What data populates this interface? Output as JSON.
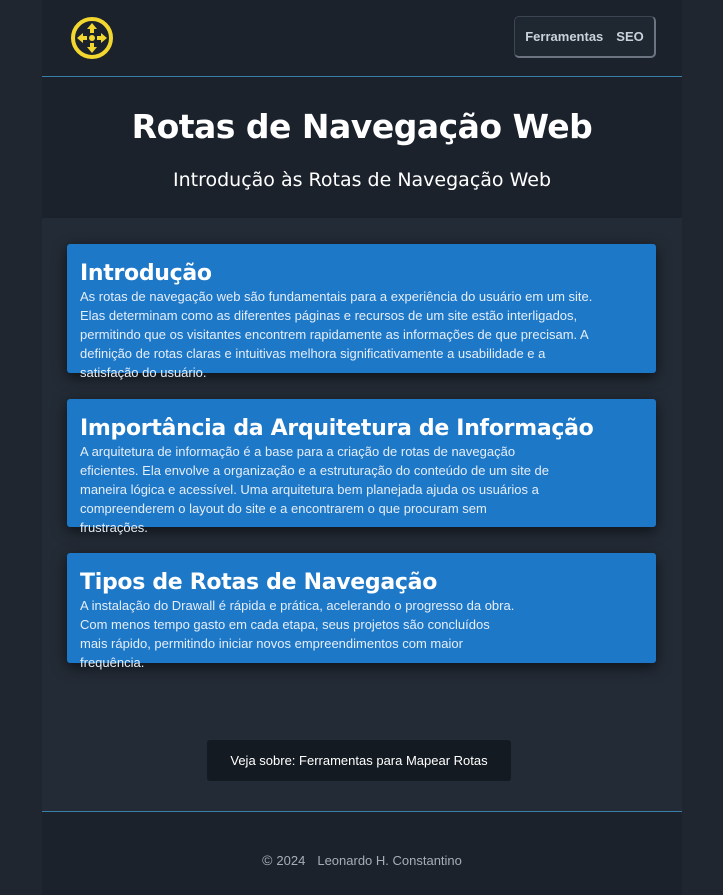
{
  "header": {
    "logo": "crosshair-arrows-icon",
    "nav": [
      {
        "label": "Ferramentas"
      },
      {
        "label": "SEO"
      }
    ]
  },
  "hero": {
    "title": "Rotas de Navegação Web",
    "subtitle": "Introdução às Rotas de Navegação Web"
  },
  "cards": [
    {
      "title": "Introdução",
      "text": "As rotas de navegação web são fundamentais para a experiência do usuário em um site. Elas determinam como as diferentes páginas e recursos de um site estão interligados, permitindo que os visitantes encontrem rapidamente as informações de que precisam. A definição de rotas claras e intuitivas melhora significativamente a usabilidade e a satisfação do usuário."
    },
    {
      "title": "Importância da Arquitetura de Informação",
      "text": "A arquitetura de informação é a base para a criação de rotas de navegação eficientes. Ela envolve a organização e a estruturação do conteúdo de um site de maneira lógica e acessível. Uma arquitetura bem planejada ajuda os usuários a compreenderem o layout do site e a encontrarem o que procuram sem frustrações."
    },
    {
      "title": "Tipos de Rotas de Navegação",
      "text": "A instalação do Drawall é rápida e prática, acelerando o progresso da obra. Com menos tempo gasto em cada etapa, seus projetos são concluídos mais rápido, permitindo iniciar novos empreendimentos com maior frequência."
    }
  ],
  "see_also": {
    "label": "Veja sobre: Ferramentas para Mapear Rotas"
  },
  "footer": {
    "copyright_symbol": "©",
    "year": "2024",
    "author": "Leonardo H. Constantino"
  },
  "colors": {
    "accent": "#1e78c8",
    "logo_yellow": "#f2d72e",
    "divider": "#3a7fa8"
  }
}
